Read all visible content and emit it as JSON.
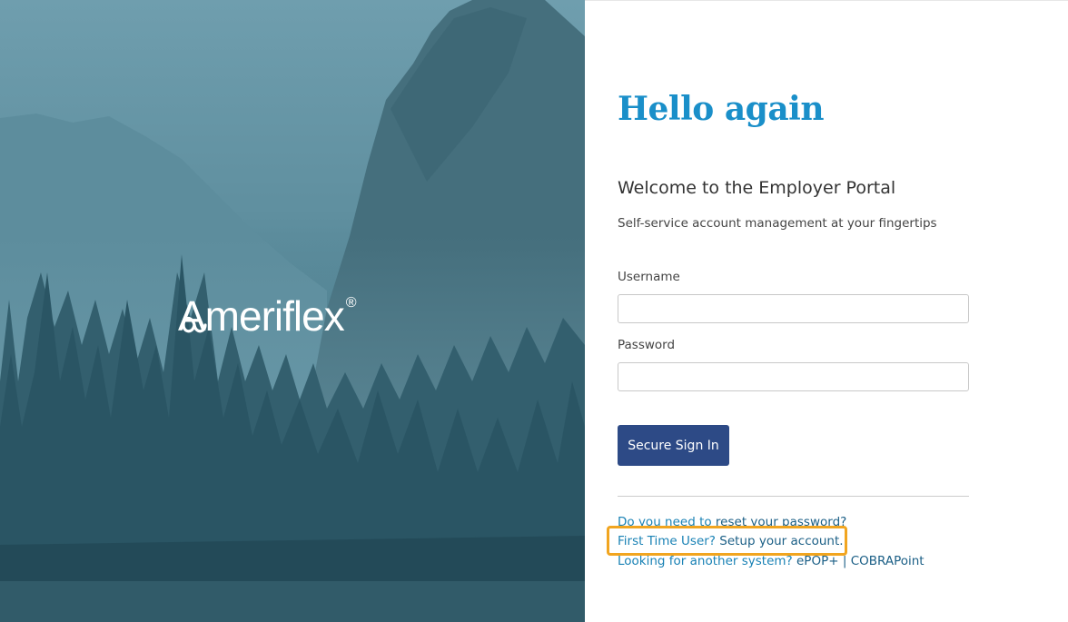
{
  "brand": {
    "name": "Ameriflex",
    "registered_mark": "®"
  },
  "login": {
    "greeting": "Hello again",
    "welcome": "Welcome to the Employer Portal",
    "tagline": "Self-service account management at your fingertips",
    "username_label": "Username",
    "username_value": "",
    "password_label": "Password",
    "password_value": "",
    "signin_label": "Secure Sign In"
  },
  "links": {
    "reset_prefix": "Do you need to",
    "reset_link": "reset your password?",
    "first_time_prefix": "First Time User?",
    "setup_link": "Setup your account.",
    "other_prefix": "Looking for another system?",
    "epop_link": "ePOP+",
    "separator": "|",
    "cobra_link": "COBRAPoint"
  },
  "colors": {
    "accent": "#1a8fc9",
    "button": "#2d4a86",
    "highlight": "#f1a520"
  }
}
